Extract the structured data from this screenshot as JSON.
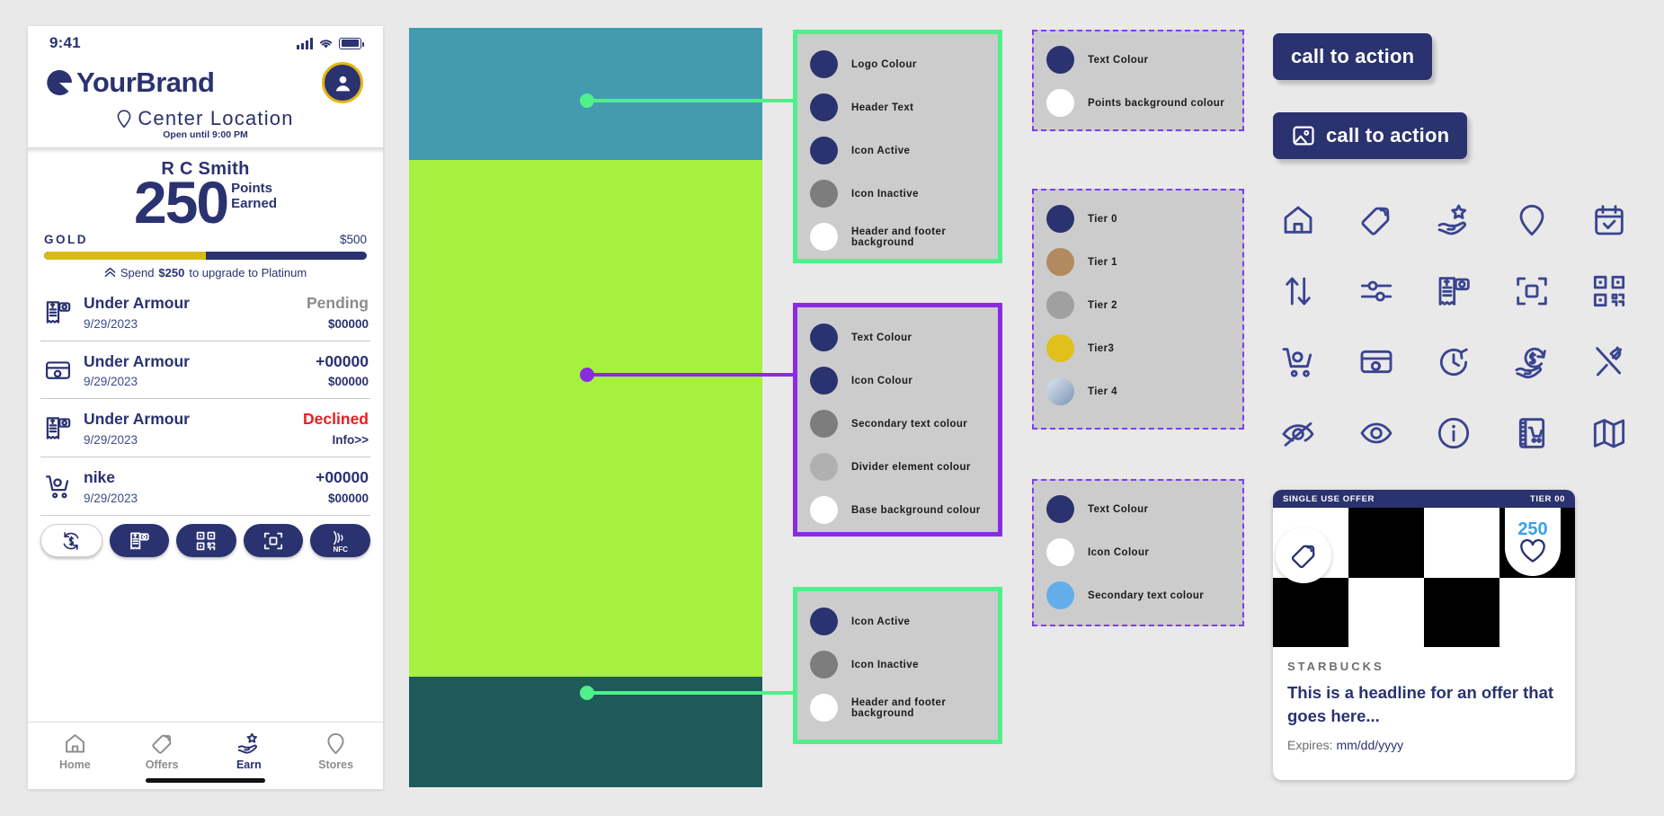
{
  "phone": {
    "status_bar": {
      "time": "9:41"
    },
    "header": {
      "brand_name": "YourBrand",
      "location": "Center Location",
      "hours": "Open until 9:00 PM"
    },
    "points": {
      "member_name": "R C Smith",
      "points_value": "250",
      "points_label_line1": "Points",
      "points_label_line2": "Earned",
      "tier_name": "GOLD",
      "tier_goal": "$500",
      "progress_percent": 50,
      "upgrade_prefix": "Spend ",
      "upgrade_amount": "$250",
      "upgrade_suffix": " to upgrade to Platinum"
    },
    "transactions": [
      {
        "icon": "receipt-camera-icon",
        "merchant": "Under Armour",
        "date": "9/29/2023",
        "status": "Pending",
        "status_style": "muted",
        "amount": "$00000"
      },
      {
        "icon": "card-link-icon",
        "merchant": "Under Armour",
        "date": "9/29/2023",
        "status": "+00000",
        "status_style": "normal",
        "amount": "$00000"
      },
      {
        "icon": "receipt-camera-icon",
        "merchant": "Under Armour",
        "date": "9/29/2023",
        "status": "Declined",
        "status_style": "declined",
        "amount": "Info>>"
      },
      {
        "icon": "cart-link-icon",
        "merchant": "nike",
        "date": "9/29/2023",
        "status": "+00000",
        "status_style": "normal",
        "amount": "$00000"
      }
    ],
    "action_pills": [
      {
        "name": "refresh-dollar-icon",
        "label": ""
      },
      {
        "name": "receipt-camera-icon",
        "label": ""
      },
      {
        "name": "qr-code-icon",
        "label": ""
      },
      {
        "name": "scan-frame-icon",
        "label": ""
      },
      {
        "name": "nfc-icon",
        "label": "NFC"
      }
    ],
    "bottom_nav": [
      {
        "icon": "home-icon",
        "label": "Home",
        "active": false
      },
      {
        "icon": "offers-tag-icon",
        "label": "Offers",
        "active": false
      },
      {
        "icon": "earn-star-hand-icon",
        "label": "Earn",
        "active": true
      },
      {
        "icon": "stores-pin-icon",
        "label": "Stores",
        "active": false
      }
    ]
  },
  "color_blocks": [
    {
      "name": "header-block",
      "color": "#439bb0",
      "height": 145
    },
    {
      "name": "body-block",
      "color": "#a2f councilor"
    },
    {
      "name": "footer-block",
      "color": "#1f5a5a",
      "height": 120
    }
  ],
  "blocks": {
    "header_color": "#439bb0",
    "body_color": "#a6f13f",
    "footer_color": "#1d5a59"
  },
  "connectors": {
    "top_color": "#4ff08a",
    "mid_color": "#8a2be2",
    "bottom_color": "#4ff08a"
  },
  "panels": {
    "header_panel": {
      "border_color": "#4ff08a",
      "swatches": [
        {
          "label": "Logo Colour",
          "color": "#2a3270"
        },
        {
          "label": "Header Text",
          "color": "#2a3270"
        },
        {
          "label": "Icon Active",
          "color": "#2a3270"
        },
        {
          "label": "Icon Inactive",
          "color": "#7d7d7d"
        },
        {
          "label": "Header and footer background",
          "color": "#ffffff"
        }
      ]
    },
    "body_panel": {
      "border_color": "#8a2be2",
      "swatches": [
        {
          "label": "Text  Colour",
          "color": "#2a3270"
        },
        {
          "label": "Icon Colour",
          "color": "#2a3270"
        },
        {
          "label": "Secondary text colour",
          "color": "#7d7d7d"
        },
        {
          "label": "Divider element colour",
          "color": "#b0b0b0"
        },
        {
          "label": "Base background colour",
          "color": "#ffffff"
        }
      ]
    },
    "footer_panel": {
      "border_color": "#4ff08a",
      "swatches": [
        {
          "label": "Icon Active",
          "color": "#2a3270"
        },
        {
          "label": "Icon Inactive",
          "color": "#7d7d7d"
        },
        {
          "label": "Header and footer background",
          "color": "#ffffff"
        }
      ]
    },
    "points_panel": {
      "border_color": "#7b3ff2",
      "swatches": [
        {
          "label": "Text Colour",
          "color": "#2a3270"
        },
        {
          "label": "Points background colour",
          "color": "#ffffff"
        }
      ]
    },
    "tier_panel": {
      "border_color": "#7b3ff2",
      "swatches": [
        {
          "label": "Tier 0",
          "color": "#2a3270"
        },
        {
          "label": "Tier 1",
          "color": "#b18a60"
        },
        {
          "label": "Tier 2",
          "color": "#a0a0a0"
        },
        {
          "label": "Tier3",
          "color": "#e0c01a"
        },
        {
          "label": "Tier 4",
          "color": "linear-gradient(135deg,#dfe7f0,#7b93b5)"
        }
      ]
    },
    "offer_panel": {
      "border_color": "#7b3ff2",
      "swatches": [
        {
          "label": "Text  Colour",
          "color": "#2a3270"
        },
        {
          "label": "Icon Colour",
          "color": "#ffffff"
        },
        {
          "label": "Secondary text colour",
          "color": "#63aeea"
        }
      ]
    }
  },
  "ctas": [
    {
      "label": "call to action",
      "has_icon": false
    },
    {
      "label": "call to action",
      "has_icon": true,
      "icon": "image-icon"
    }
  ],
  "icon_grid": [
    [
      "home-icon",
      "offers-tag-icon",
      "earn-star-hand-icon",
      "location-pin-icon",
      "calendar-check-icon"
    ],
    [
      "sort-arrows-icon",
      "filter-sliders-icon",
      "receipt-camera-icon",
      "scan-frame-icon",
      "qr-code-icon"
    ],
    [
      "cart-link-icon",
      "card-link-icon",
      "timer-icon",
      "cashback-hand-icon",
      "dining-icon"
    ],
    [
      "eye-off-icon",
      "eye-icon",
      "info-icon",
      "catalog-cart-icon",
      "map-icon"
    ]
  ],
  "offer_card": {
    "tag_left": "SINGLE USE OFFER",
    "tag_right": "TIER 00",
    "points": "250",
    "brand": "STARBUCKS",
    "headline": "This is a headline for an offer that goes here...",
    "expires_label": "Expires:",
    "expires_value": "mm/dd/yyyy",
    "heart_icon": "heart-icon",
    "tag_icon": "offers-tag-icon"
  }
}
